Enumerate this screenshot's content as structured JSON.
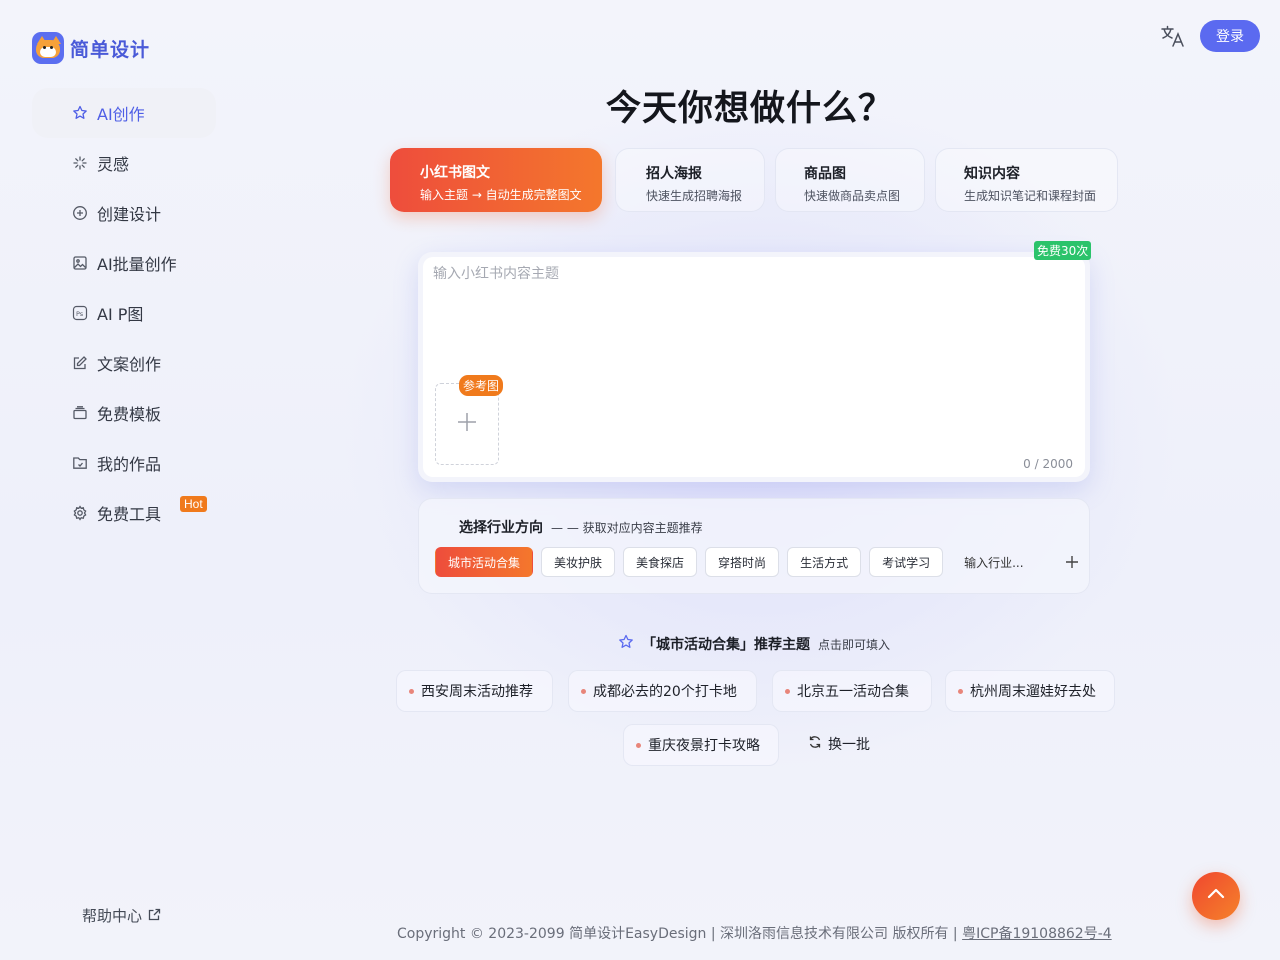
{
  "brand": {
    "name": "简单设计"
  },
  "header": {
    "login_label": "登录"
  },
  "sidebar": {
    "items": [
      {
        "label": "AI创作",
        "icon": "star-icon"
      },
      {
        "label": "灵感",
        "icon": "sparkle-icon"
      },
      {
        "label": "创建设计",
        "icon": "plus-circle-icon"
      },
      {
        "label": "AI批量创作",
        "icon": "image-icon"
      },
      {
        "label": "AI P图",
        "icon": "ps-icon"
      },
      {
        "label": "文案创作",
        "icon": "edit-icon"
      },
      {
        "label": "免费模板",
        "icon": "template-icon"
      },
      {
        "label": "我的作品",
        "icon": "folder-icon"
      },
      {
        "label": "免费工具",
        "icon": "gear-icon",
        "badge": "Hot"
      }
    ],
    "help_label": "帮助中心"
  },
  "main": {
    "title": "今天你想做什么？",
    "tabs": [
      {
        "title": "小红书图文",
        "desc": "输入主题 → 自动生成完整图文"
      },
      {
        "title": "招人海报",
        "desc": "快速生成招聘海报"
      },
      {
        "title": "商品图",
        "desc": "快速做商品卖点图"
      },
      {
        "title": "知识内容",
        "desc": "生成知识笔记和课程封面"
      }
    ],
    "editor": {
      "free_badge": "免费30次",
      "placeholder": "输入小红书内容主题",
      "ref_badge": "参考图",
      "counter": "0 / 2000"
    },
    "industry": {
      "title": "选择行业方向",
      "subtitle": "— — 获取对应内容主题推荐",
      "chips": [
        "城市活动合集",
        "美妆护肤",
        "美食探店",
        "穿搭时尚",
        "生活方式",
        "考试学习",
        "输入行业..."
      ]
    },
    "recommend": {
      "title": "「城市活动合集」推荐主题",
      "subtitle": "点击即可填入",
      "items": [
        "西安周末活动推荐",
        "成都必去的20个打卡地",
        "北京五一活动合集",
        "杭州周末遛娃好去处",
        "重庆夜景打卡攻略"
      ],
      "refresh_label": "换一批"
    }
  },
  "footer": {
    "copyright": "Copyright © 2023-2099 简单设计EasyDesign | 深圳洛雨信息技术有限公司 版权所有 | ",
    "icp": "粤ICP备19108862号-4"
  },
  "colors": {
    "accent": "#5b6af0",
    "orange": "#f07a1c",
    "green": "#2bc36b"
  }
}
